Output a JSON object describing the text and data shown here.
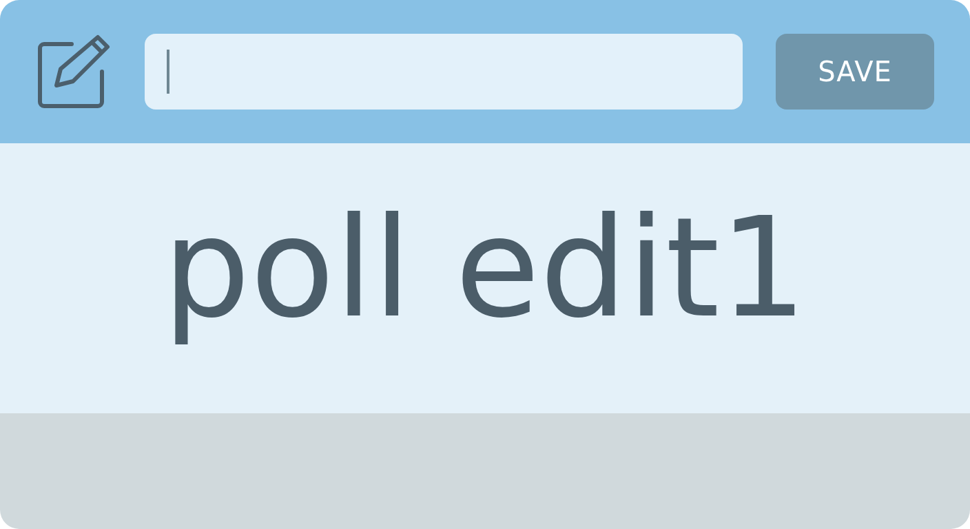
{
  "toolbar": {
    "input": {
      "focused": true
    },
    "save_button": "SAVE"
  },
  "content": {
    "title": "poll edit1"
  }
}
